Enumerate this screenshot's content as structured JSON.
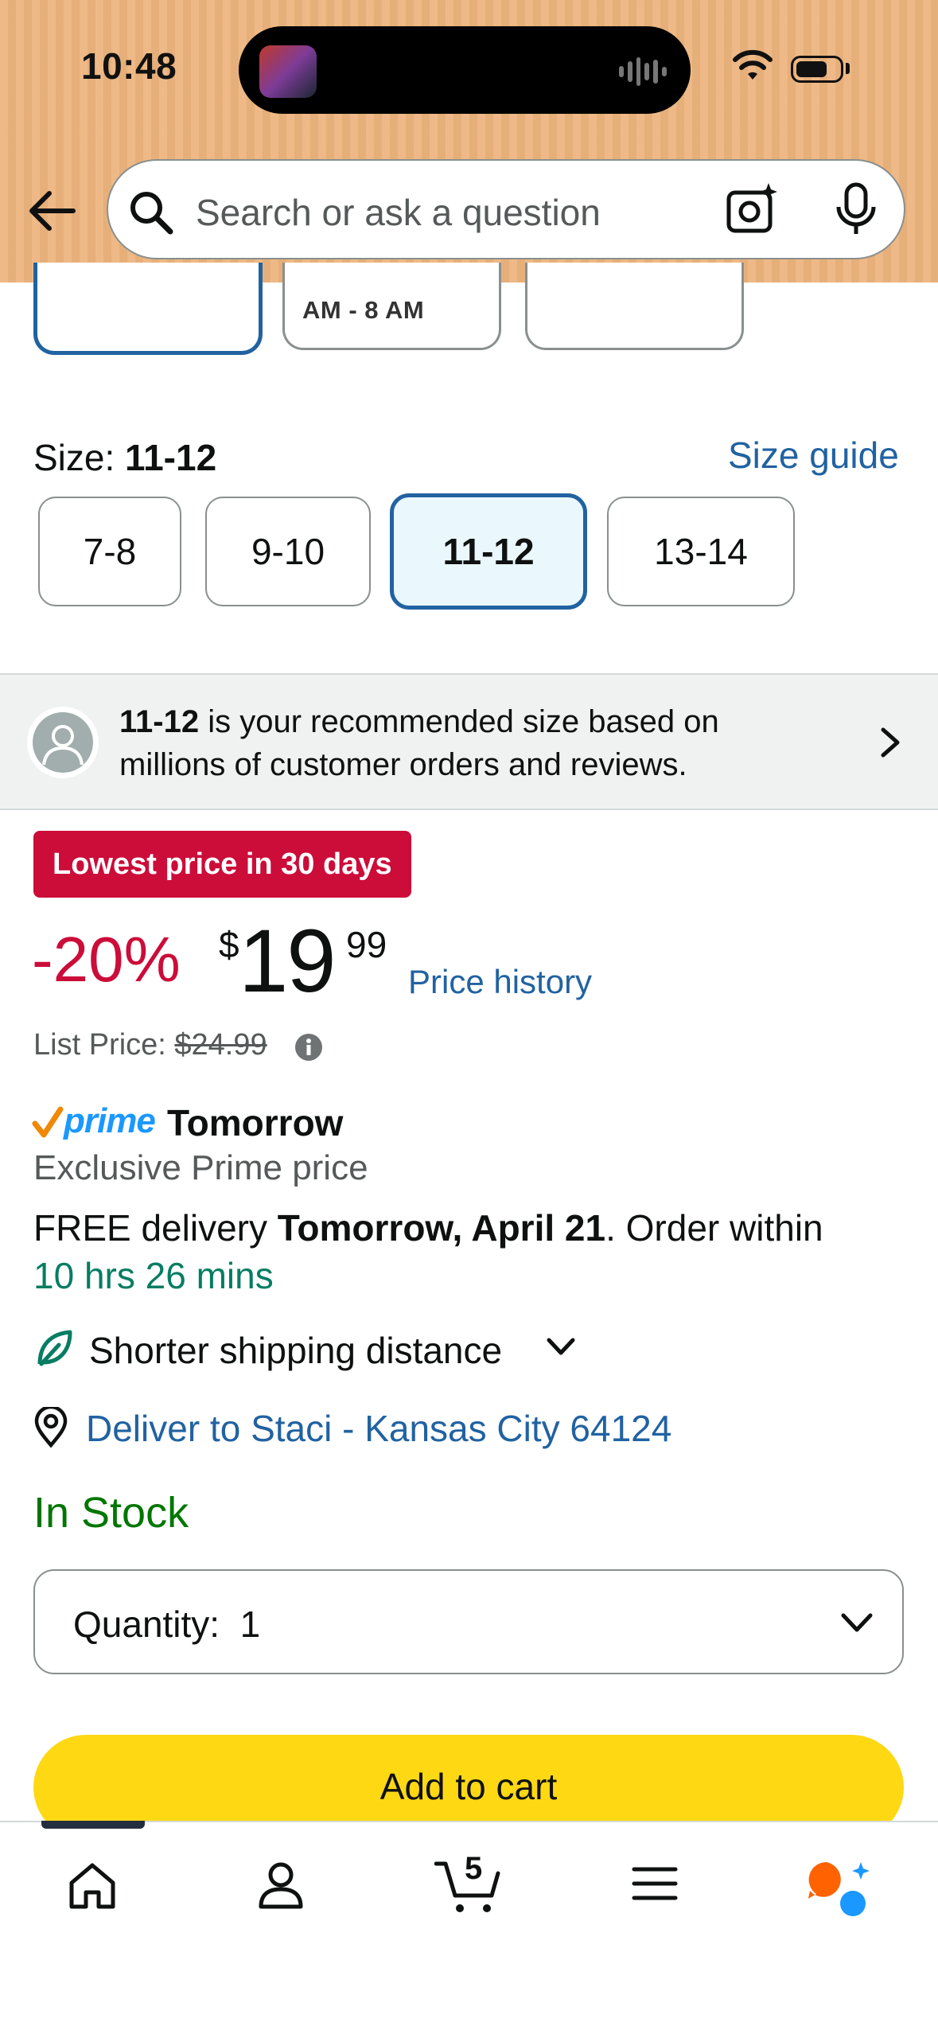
{
  "status_bar": {
    "time": "10:48"
  },
  "search": {
    "placeholder": "Search or ask a question"
  },
  "delivery_option": {
    "partial_text": "AM - 8 AM"
  },
  "size": {
    "label": "Size:",
    "selected": "11-12",
    "guide_link": "Size guide",
    "options": [
      "7-8",
      "9-10",
      "11-12",
      "13-14"
    ]
  },
  "recommendation": {
    "size": "11-12",
    "text": " is your recommended size based on millions of customer orders and reviews."
  },
  "price": {
    "badge": "Lowest price in 30 days",
    "discount": "-20%",
    "currency": "$",
    "whole": "19",
    "fraction": "99",
    "history_link": "Price history",
    "list_label": "List Price:",
    "list_value": "$24.99"
  },
  "delivery": {
    "prime_label": "prime",
    "prime_day": "Tomorrow",
    "exclusive": "Exclusive Prime price",
    "free_prefix": "FREE delivery ",
    "date": "Tomorrow, April 21",
    "order_within": ". Order within",
    "countdown": "10 hrs 26 mins",
    "shorter_shipping": "Shorter shipping distance",
    "deliver_to": "Deliver to Staci - Kansas City 64124"
  },
  "stock": {
    "status": "In Stock"
  },
  "quantity": {
    "label": "Quantity:",
    "value": "1"
  },
  "cart": {
    "add_label": "Add to cart",
    "count": "5"
  },
  "colors": {
    "header_bg": "#edb57e",
    "link_blue": "#2162a1",
    "deal_red": "#cc0c39",
    "stock_green": "#007600",
    "countdown_green": "#067d62",
    "atc_yellow": "#ffd814"
  },
  "nav": {
    "items": [
      "home-icon",
      "account-icon",
      "cart-icon",
      "menu-icon",
      "rufus-icon"
    ]
  }
}
